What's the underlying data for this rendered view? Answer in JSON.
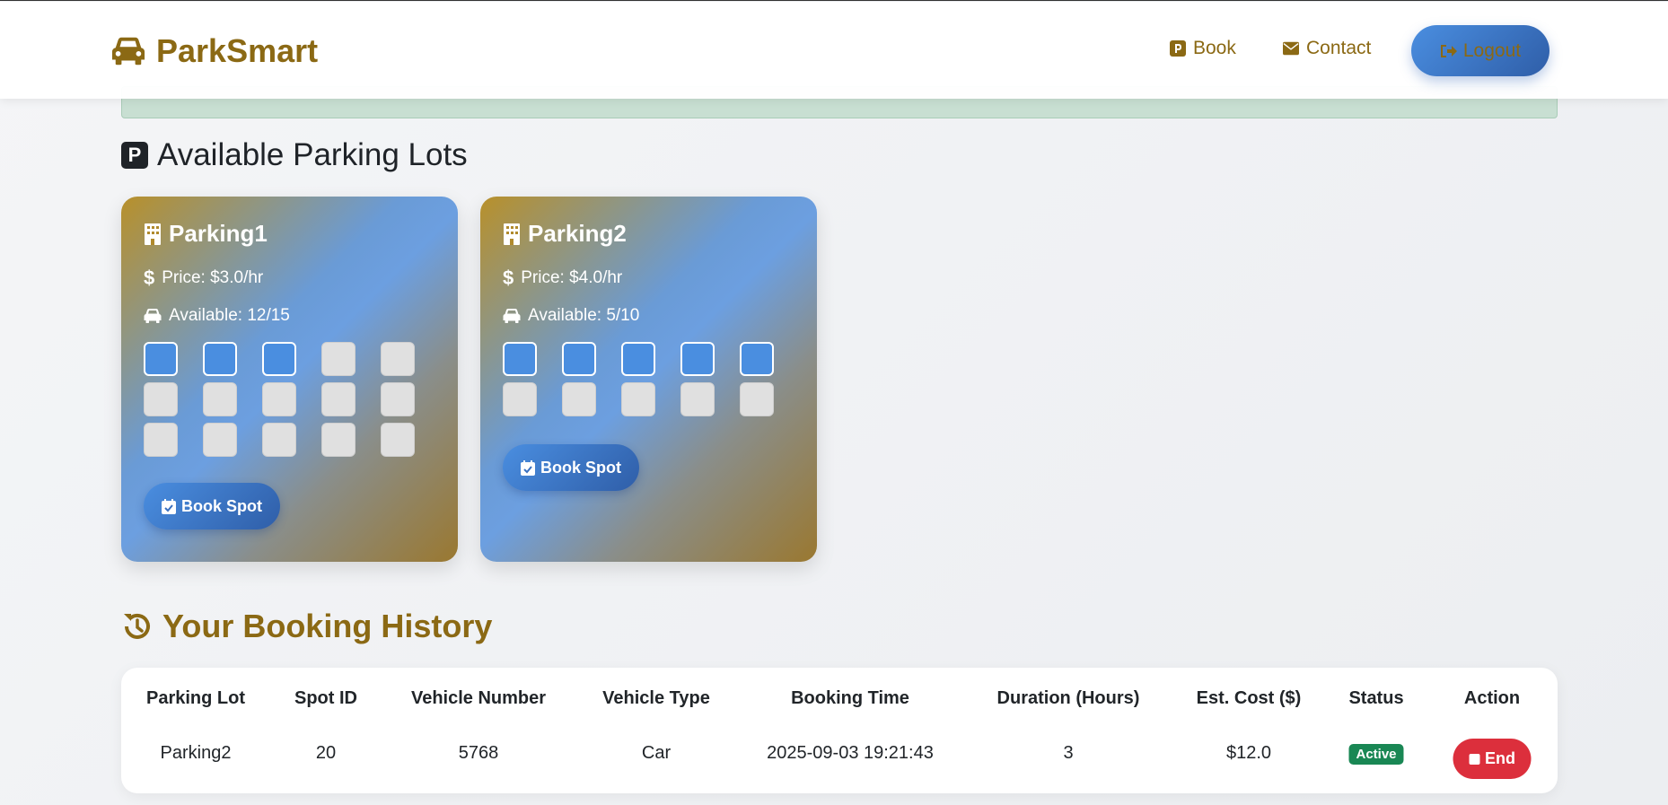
{
  "brand": {
    "name": "ParkSmart",
    "icon": "car-icon"
  },
  "nav": {
    "book_label": "Book",
    "contact_label": "Contact",
    "logout_label": "Logout"
  },
  "lots_section": {
    "title": "Available Parking Lots",
    "icon": "parking-icon"
  },
  "lots": [
    {
      "name": "Parking1",
      "price": "Price: $3.0/hr",
      "available": "Available: 12/15",
      "spots_total": 15,
      "spots_free": 3,
      "button_label": "Book Spot"
    },
    {
      "name": "Parking2",
      "price": "Price: $4.0/hr",
      "available": "Available: 5/10",
      "spots_total": 10,
      "spots_free": 5,
      "button_label": "Book Spot"
    }
  ],
  "history_section": {
    "title": "Your Booking History",
    "icon": "history-icon"
  },
  "table": {
    "headers": [
      "Parking Lot",
      "Spot ID",
      "Vehicle Number",
      "Vehicle Type",
      "Booking Time",
      "Duration (Hours)",
      "Est. Cost ($)",
      "Status",
      "Action"
    ],
    "rows": [
      {
        "lot": "Parking2",
        "spot_id": "20",
        "vehicle_number": "5768",
        "vehicle_type": "Car",
        "booking_time": "2025-09-03 19:21:43",
        "duration": "3",
        "cost": "$12.0",
        "status": "Active",
        "action_label": "End"
      }
    ]
  },
  "colors": {
    "brand": "#8b6914",
    "button_blue": "#4a8ee0",
    "status_active": "#198754",
    "end_red": "#dc2f3c",
    "spot_free": "#4a8ee0",
    "spot_taken": "#e0e0e0"
  }
}
